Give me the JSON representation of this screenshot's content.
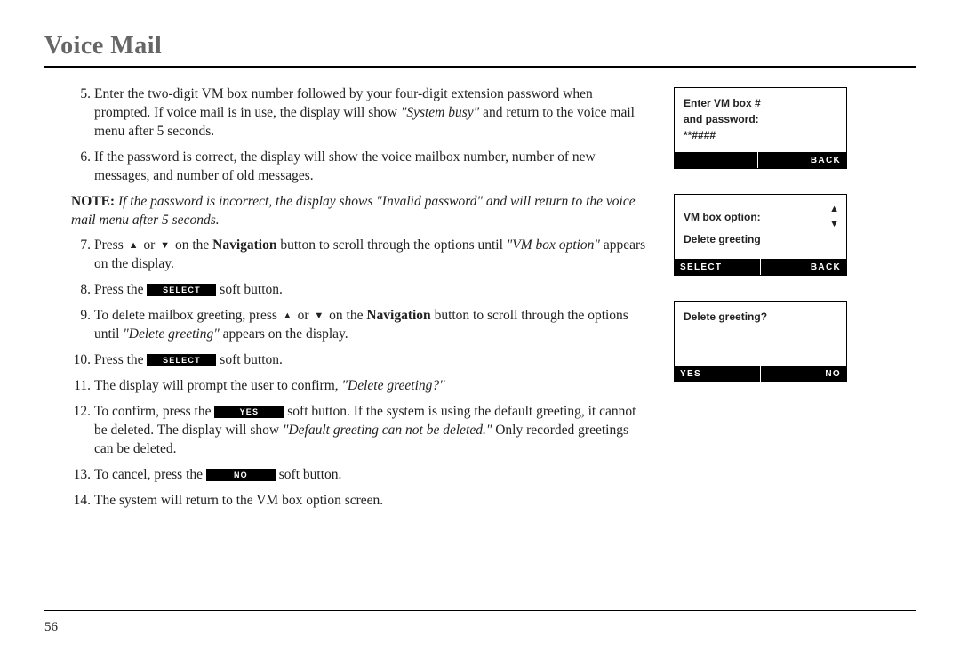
{
  "title": "Voice Mail",
  "page_number": "56",
  "steps": [
    {
      "num": "5.",
      "parts": [
        {
          "t": "Enter the two-digit VM box number followed by your four-digit extension password when prompted. If voice mail is in use, the display will show "
        },
        {
          "t": "\"System busy\"",
          "cls": "quoted"
        },
        {
          "t": " and return to the voice mail menu after 5 seconds."
        }
      ]
    },
    {
      "num": "6.",
      "parts": [
        {
          "t": "If the password is correct, the display will show the voice mailbox number, number of new messages, and number of old messages."
        }
      ]
    },
    {
      "num": "7.",
      "parts": [
        {
          "t": "Press "
        },
        {
          "icon": "up"
        },
        {
          "t": " or "
        },
        {
          "icon": "down"
        },
        {
          "t": " on the "
        },
        {
          "t": "Navigation",
          "cls": "bold"
        },
        {
          "t": " button to scroll through the options until "
        },
        {
          "t": "\"VM box option\"",
          "cls": "quoted"
        },
        {
          "t": " appears on the display."
        }
      ]
    },
    {
      "num": "8.",
      "parts": [
        {
          "t": "Press the "
        },
        {
          "btn": "SELECT"
        },
        {
          "t": " soft button."
        }
      ]
    },
    {
      "num": "9.",
      "parts": [
        {
          "t": "To delete mailbox greeting, press "
        },
        {
          "icon": "up"
        },
        {
          "t": " or "
        },
        {
          "icon": "down"
        },
        {
          "t": " on the "
        },
        {
          "t": "Navigation",
          "cls": "bold"
        },
        {
          "t": " button to scroll through the options until "
        },
        {
          "t": "\"Delete greeting\"",
          "cls": "quoted"
        },
        {
          "t": " appears on the display."
        }
      ]
    },
    {
      "num": "10.",
      "parts": [
        {
          "t": "Press the "
        },
        {
          "btn": "SELECT"
        },
        {
          "t": " soft button."
        }
      ]
    },
    {
      "num": "11.",
      "parts": [
        {
          "t": "The display will prompt the user to confirm, "
        },
        {
          "t": "\"Delete greeting?\"",
          "cls": "quoted"
        }
      ]
    },
    {
      "num": "12.",
      "parts": [
        {
          "t": "To confirm, press the "
        },
        {
          "btn": "YES"
        },
        {
          "t": " soft button. If the system is using the default greeting, it cannot be deleted. The display will show "
        },
        {
          "t": "\"Default greeting can not be deleted.\"",
          "cls": "quoted"
        },
        {
          "t": " Only recorded greetings can be deleted."
        }
      ]
    },
    {
      "num": "13.",
      "parts": [
        {
          "t": "To cancel, press the "
        },
        {
          "btn": "NO"
        },
        {
          "t": " soft button."
        }
      ]
    },
    {
      "num": "14.",
      "parts": [
        {
          "t": "The system will return to the VM box option screen."
        }
      ]
    }
  ],
  "note": {
    "label": "NOTE:",
    "text": "If the password is incorrect, the display shows \"Invalid password\" and will return to the voice mail menu after 5 seconds."
  },
  "screens": [
    {
      "lines": [
        "Enter VM box #",
        "and password:",
        "**####"
      ],
      "left_soft": "",
      "right_soft": "BACK"
    },
    {
      "option_line": "VM box option:",
      "lines": [
        "Delete greeting",
        ""
      ],
      "left_soft": "SELECT",
      "right_soft": "BACK"
    },
    {
      "lines": [
        "",
        "Delete greeting?",
        ""
      ],
      "left_soft": "YES",
      "right_soft": "NO"
    }
  ],
  "icons": {
    "up": "▲",
    "down": "▼",
    "updown": "▲▼"
  }
}
